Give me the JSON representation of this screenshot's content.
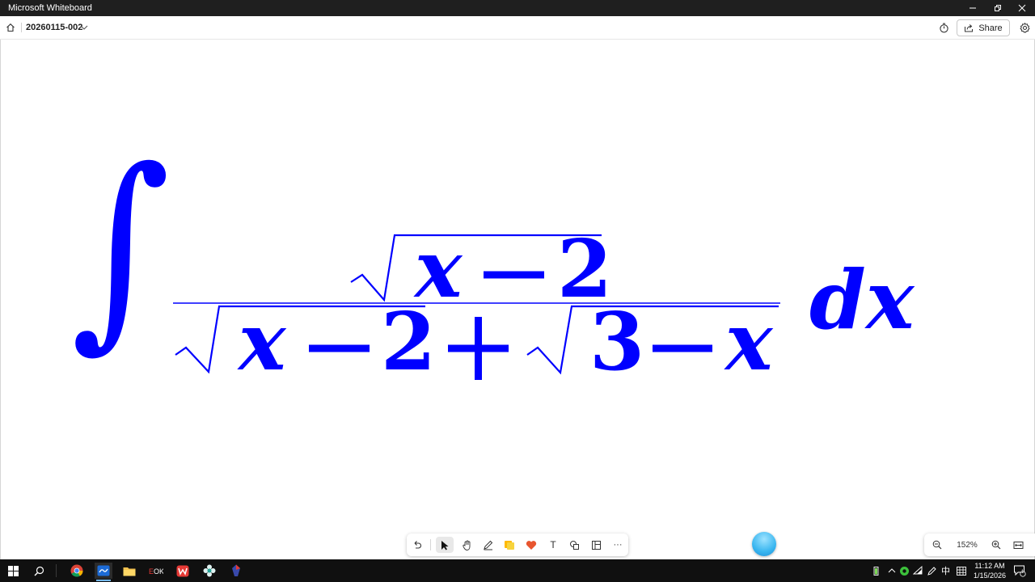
{
  "window": {
    "title": "Microsoft Whiteboard"
  },
  "header": {
    "board_name": "20260115-002",
    "share_label": "Share"
  },
  "canvas": {
    "formula": {
      "integral_sign": "∫",
      "numerator": {
        "radicand_x": "x",
        "radicand_rest": "−2"
      },
      "denominator": {
        "first_radicand_x": "x",
        "first_radicand_rest": "−2",
        "plus": "+",
        "second_radicand_num": "3",
        "second_radicand_rest": "−",
        "second_radicand_x": "x"
      },
      "differential": "dx"
    },
    "ink_color": "#0000ff"
  },
  "toolbar": {
    "tools": [
      "undo-icon",
      "select-icon",
      "pan-icon",
      "pen-icon",
      "sticky-note-icon",
      "reaction-icon",
      "text-icon",
      "shapes-icon",
      "templates-icon",
      "more-icon"
    ],
    "text_tool_glyph": "T",
    "more_glyph": "···"
  },
  "zoom": {
    "level": "152%"
  },
  "taskbar": {
    "tray_lang": "中",
    "clock_time": "11:12 AM",
    "clock_date": "1/15/2026",
    "notification_count": "1"
  }
}
